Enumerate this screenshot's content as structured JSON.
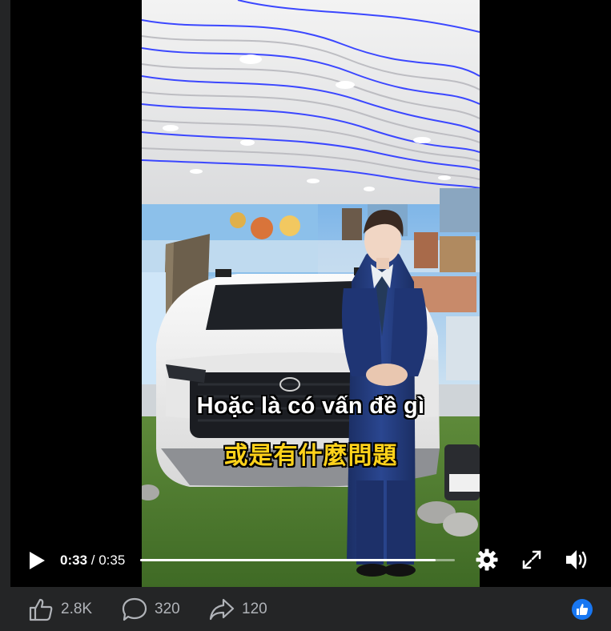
{
  "video": {
    "subtitle_vi": "Hoặc là có vấn đề gì",
    "subtitle_zh": "或是有什麼問題"
  },
  "controls": {
    "current_time": "0:33",
    "separator": " / ",
    "duration": "0:35",
    "progress": 0.94
  },
  "actions": {
    "likes": "2.8K",
    "comments": "320",
    "shares": "120"
  },
  "icons": {
    "play": "play-icon",
    "settings": "gear-icon",
    "fullscreen": "fullscreen-icon",
    "volume": "volume-icon",
    "like": "thumbs-up-icon",
    "comment": "comment-icon",
    "share": "share-icon",
    "reaction": "like-reaction-icon"
  },
  "colors": {
    "page_bg": "#242526",
    "player_bg": "#000000",
    "action_text": "#b0b3b8",
    "subtitle_primary": "#ffffff",
    "subtitle_secondary": "#ffd21a",
    "reaction_blue": "#1877f2",
    "ceiling_light_strip": "#2f3cff"
  }
}
